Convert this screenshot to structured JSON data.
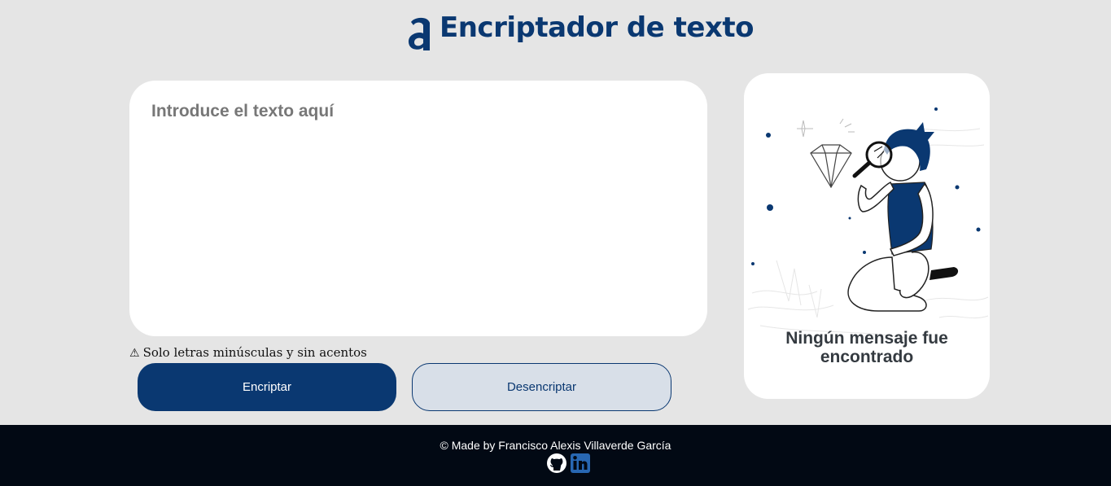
{
  "header": {
    "title": "Encriptador de texto"
  },
  "editor": {
    "placeholder": "Introduce el texto aquí",
    "value": ""
  },
  "hint": {
    "icon": "⚠",
    "text": "Solo letras minúsculas y sin acentos"
  },
  "buttons": {
    "encrypt_label": "Encriptar",
    "decrypt_label": "Desencriptar"
  },
  "output": {
    "message_line1": "Ningún mensaje fue",
    "message_line2": "encontrado",
    "illustration_icon": "person-with-magnifier-illustration"
  },
  "footer": {
    "credit": "© Made by Francisco Alexis Villaverde García",
    "links": [
      {
        "icon": "github-icon"
      },
      {
        "icon": "linkedin-icon"
      }
    ]
  },
  "colors": {
    "accent": "#0a3871",
    "background": "#e5e5e5",
    "panel": "#ffffff",
    "footer": "#020914",
    "secondary_button": "#d8dfe8"
  }
}
